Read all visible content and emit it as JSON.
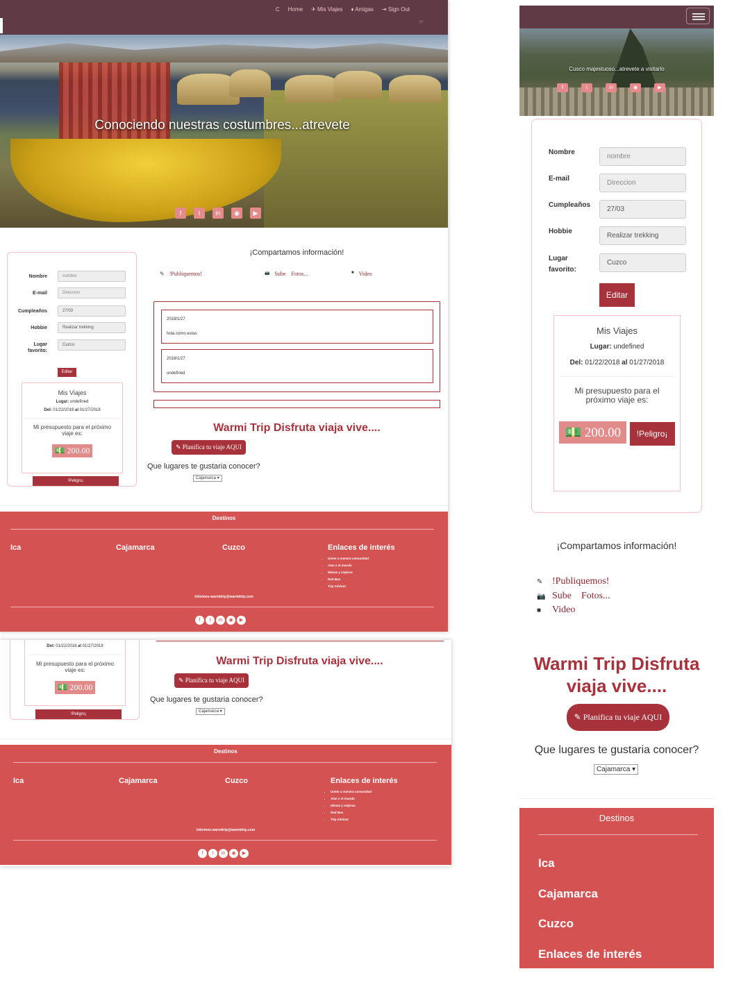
{
  "nav": {
    "icon_top": "⮈",
    "links": [
      "Home",
      "Mis Viajes",
      "Amigas",
      "Sign Out"
    ],
    "link_icons": [
      "✈",
      "♦",
      "⇥"
    ],
    "icon_bottom": "☞"
  },
  "hero": {
    "title": "Conociendo nuestras costumbres...atrevete",
    "social": [
      "f",
      "t",
      "in",
      "◉",
      "▶"
    ]
  },
  "profile": {
    "fields": [
      {
        "label": "Nombre",
        "value": "nombre",
        "placeholder": true
      },
      {
        "label": "E-mail",
        "value": "Direccion",
        "placeholder": true
      },
      {
        "label": "Cumpleaños",
        "value": "27/03",
        "placeholder": false
      },
      {
        "label": "Hobbie",
        "value": "Realizar trekking",
        "placeholder": false
      },
      {
        "label": "Lugar favorito:",
        "value": "Cuzco",
        "placeholder": false
      }
    ],
    "edit_label": "Editar"
  },
  "trip": {
    "title": "Mis Viajes",
    "place_label": "Lugar:",
    "place_value": "undefined",
    "dates_label": "Del:",
    "date_from": "01/22/2018",
    "dates_sep": "al",
    "date_to": "01/27/2018",
    "budget_text": "Mi presupuesto para el próximo viaje es:",
    "money_icon": "💵",
    "budget": "200.00",
    "danger_label": "!Peligro¡"
  },
  "share": {
    "title": "¡Compartamos información!",
    "tabs": [
      {
        "icon": "✎",
        "label": "!Publiquemos!"
      },
      {
        "icon": "📷",
        "label": "Sube    Fotos..."
      },
      {
        "icon": "■",
        "label": "Video"
      }
    ],
    "posts": [
      {
        "date": "2018/1/27",
        "text": "hola como estas"
      },
      {
        "date": "2018/1/27",
        "text": "undefined"
      }
    ]
  },
  "brand": "Warmi Trip Disfruta viaja vive....",
  "plan_label": "✎ Planifica tu viaje AQUI",
  "question": "Que lugares te gustaria conocer?",
  "select_value": "Cajamarca",
  "select_caret": "▾",
  "footer": {
    "title": "Destinos",
    "cities": [
      "Ica",
      "Cajamarca",
      "Cuzco",
      "Enlaces de interés"
    ],
    "links": [
      "Unete a nuestra comunidad",
      "Alan x el mundo",
      "Mistas y viajeras",
      "Red Bus",
      "Trip Advisor"
    ],
    "email": "Informes-warmitrip@warmitrip.com",
    "social": [
      "f",
      "t",
      "in",
      "◉",
      "▶"
    ]
  },
  "mobile": {
    "hero_caption": "Cusco majestuoso...atrevete a visitarlo"
  }
}
